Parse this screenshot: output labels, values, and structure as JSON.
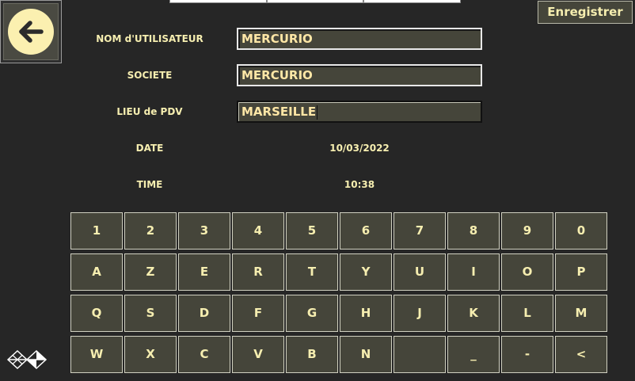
{
  "header": {
    "save_label": "Enregistrer"
  },
  "form": {
    "username_label": "NOM d'UTILISATEUR",
    "username_value": "MERCURIO",
    "company_label": "SOCIETE",
    "company_value": "MERCURIO",
    "location_label": "LIEU de PDV",
    "location_value": "MARSEILLE",
    "date_label": "DATE",
    "date_value": "10/03/2022",
    "time_label": "TIME",
    "time_value": "10:38"
  },
  "keyboard": {
    "rows": [
      [
        "1",
        "2",
        "3",
        "4",
        "5",
        "6",
        "7",
        "8",
        "9",
        "0"
      ],
      [
        "A",
        "Z",
        "E",
        "R",
        "T",
        "Y",
        "U",
        "I",
        "O",
        "P"
      ],
      [
        "Q",
        "S",
        "D",
        "F",
        "G",
        "H",
        "J",
        "K",
        "L",
        "M"
      ],
      [
        "W",
        "X",
        "C",
        "V",
        "B",
        "N",
        "",
        "_",
        "-",
        "<"
      ]
    ]
  },
  "icons": {
    "back": "arrow-left-icon",
    "logo": "brand-logo-icon"
  },
  "colors": {
    "background": "#262626",
    "text": "#f6eeb0",
    "button": "#45453a"
  }
}
